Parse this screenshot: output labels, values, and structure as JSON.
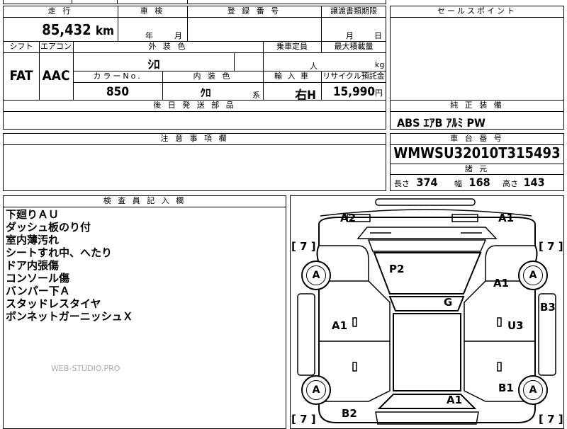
{
  "top_row": {
    "c1": "",
    "c2": "",
    "c3": ""
  },
  "mileage": {
    "label": "走 行",
    "value": "85,432",
    "unit": "km"
  },
  "inspection": {
    "label": "車 検",
    "year_unit": "年",
    "month_unit": "月"
  },
  "registration": {
    "label": "登 録 番 号",
    "value": ""
  },
  "transfer_deadline": {
    "label": "譲渡書類期限",
    "month_unit": "月",
    "day_unit": "日"
  },
  "sales_point": {
    "label": "セールスポイント",
    "value": ""
  },
  "shift": {
    "label": "シフト",
    "value": "FAT"
  },
  "aircon": {
    "label": "エアコン",
    "value": "AAC"
  },
  "exterior_color": {
    "label": "外 装 色",
    "value": "ｼﾛ"
  },
  "capacity": {
    "label": "乗車定員",
    "unit": "人"
  },
  "max_load": {
    "label": "最大積載量",
    "unit": "kg"
  },
  "color_no": {
    "label": "カラーNo.",
    "value": "850"
  },
  "interior_color": {
    "label": "内 装 色",
    "value": "ｸﾛ",
    "suffix": "系"
  },
  "import": {
    "label": "輸 入 車",
    "value": "右H"
  },
  "recycle": {
    "label": "リサイクル預託金",
    "value": "15,990",
    "unit": "円"
  },
  "later_parts": {
    "label": "後 日 発 送 部 品",
    "value": ""
  },
  "equipment": {
    "label": "純 正 装 備",
    "value": "ABS ｴｱB ｱﾙﾐ PW"
  },
  "notes": {
    "label": "注 意 事 項 欄",
    "value": ""
  },
  "chassis": {
    "label": "車 台 番 号",
    "value": "WMWSU32010T315493"
  },
  "specs": {
    "label": "諸 元",
    "length_label": "長さ",
    "length": "374",
    "width_label": "幅",
    "width": "168",
    "height_label": "高さ",
    "height": "143"
  },
  "inspector": {
    "label": "検 査 員 記 入 欄",
    "lines": [
      "下廻りＡＵ",
      "ダッシュ板のり付",
      "室内薄汚れ",
      "シートすれ中、へたり",
      "ドア内張傷",
      "コンソール傷",
      "バンパー下Ａ",
      "スタッドレスタイヤ",
      "ボンネットガーニッシュＸ"
    ],
    "watermark": "WEB-STUDIO.PRO"
  },
  "diagram": {
    "marks": {
      "a2_top": "A2",
      "a1_top": "A1",
      "p2": "P2",
      "a1_right": "A1",
      "g": "G",
      "b3": "B3",
      "a1_left": "A1",
      "u3": "U3",
      "b1": "B1",
      "a1_bottom": "A1",
      "b2": "B2"
    },
    "tires": [
      "A",
      "A",
      "A",
      "A"
    ],
    "tread": [
      "7",
      "7",
      "7",
      "7"
    ]
  }
}
